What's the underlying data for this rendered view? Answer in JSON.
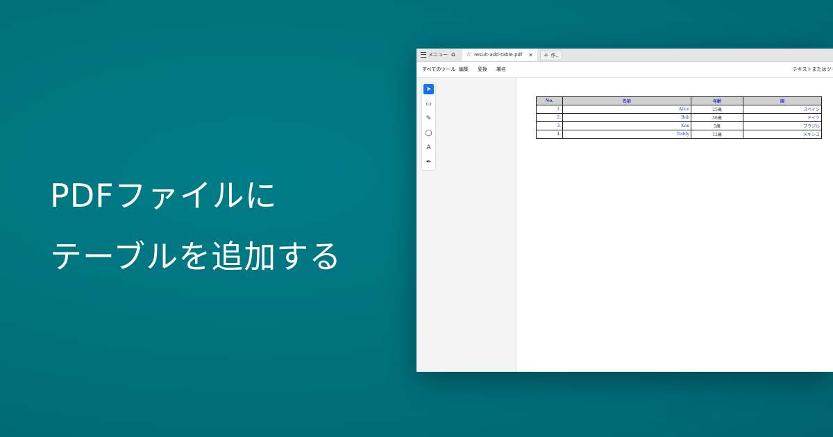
{
  "headline": {
    "line1": "PDFファイルに",
    "line2": "テーブルを追加する"
  },
  "window": {
    "tabbar": {
      "menu_label": "メニュー",
      "tab_title": "result-add-table.pdf",
      "close_glyph": "✕",
      "newtab_label": "作.."
    },
    "toolbar": {
      "items": [
        "すべてのツール",
        "編集",
        "変換",
        "署名"
      ],
      "search_text": "テキストまたはツ-"
    },
    "tools": [
      "select-tool",
      "comment-tool",
      "draw-tool",
      "lasso-tool",
      "text-tool",
      "sign-tool"
    ],
    "table": {
      "headers": [
        "No.",
        "名前",
        "年齢",
        "国"
      ],
      "rows": [
        [
          "1.",
          "Alice",
          "25歳",
          "スペイン"
        ],
        [
          "2.",
          "Bob",
          "36歳",
          "ドイツ"
        ],
        [
          "3.",
          "Ken",
          "5歳",
          "ブラジル"
        ],
        [
          "4.",
          "Teddy",
          "12歳",
          "メキシコ"
        ]
      ]
    }
  },
  "colors": {
    "background": "#007b86",
    "accent": "#1473e6",
    "table_text": "#3340c4"
  }
}
